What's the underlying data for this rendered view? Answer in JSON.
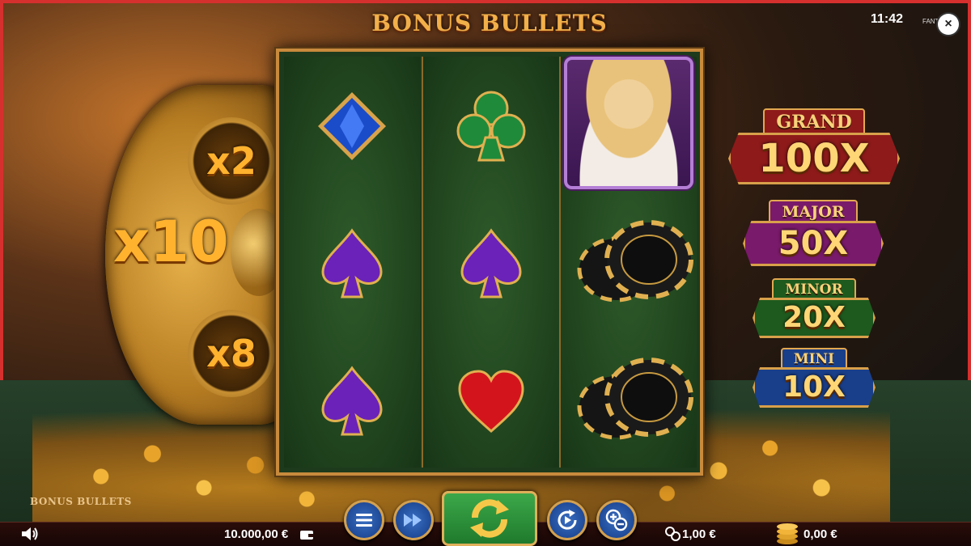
{
  "game": {
    "title": "BONUS BULLETS",
    "brand_small": "BONUS BULLETS",
    "clock": "11:42",
    "close_label": "×",
    "fant_label": "FANT"
  },
  "cylinder": {
    "multipliers": [
      "x2",
      "x10",
      "x8"
    ]
  },
  "reels": [
    {
      "symbols": [
        "blue-diamond-gem",
        "purple-spade",
        "purple-spade"
      ]
    },
    {
      "symbols": [
        "green-club",
        "purple-spade",
        "red-heart"
      ]
    },
    {
      "symbols": [
        "blonde-lady-portrait",
        "black-casino-chips",
        "black-casino-chips"
      ]
    }
  ],
  "jackpots": [
    {
      "name": "GRAND",
      "value": "100X",
      "color": "#8e1a1a"
    },
    {
      "name": "MAJOR",
      "value": "50X",
      "color": "#7a1a6a"
    },
    {
      "name": "MINOR",
      "value": "20X",
      "color": "#1e5a1e"
    },
    {
      "name": "MINI",
      "value": "10X",
      "color": "#1a3f8a"
    }
  ],
  "bottom_bar": {
    "balance": "10.000,00 €",
    "bet": "1,00 €",
    "win": "0,00 €"
  },
  "controls": {
    "menu_icon": "menu-icon",
    "turbo_icon": "fast-forward-icon",
    "spin_icon": "refresh-icon",
    "autoplay_icon": "autoplay-icon",
    "bet_icon": "plus-minus-icon",
    "sound_icon": "speaker-icon"
  }
}
